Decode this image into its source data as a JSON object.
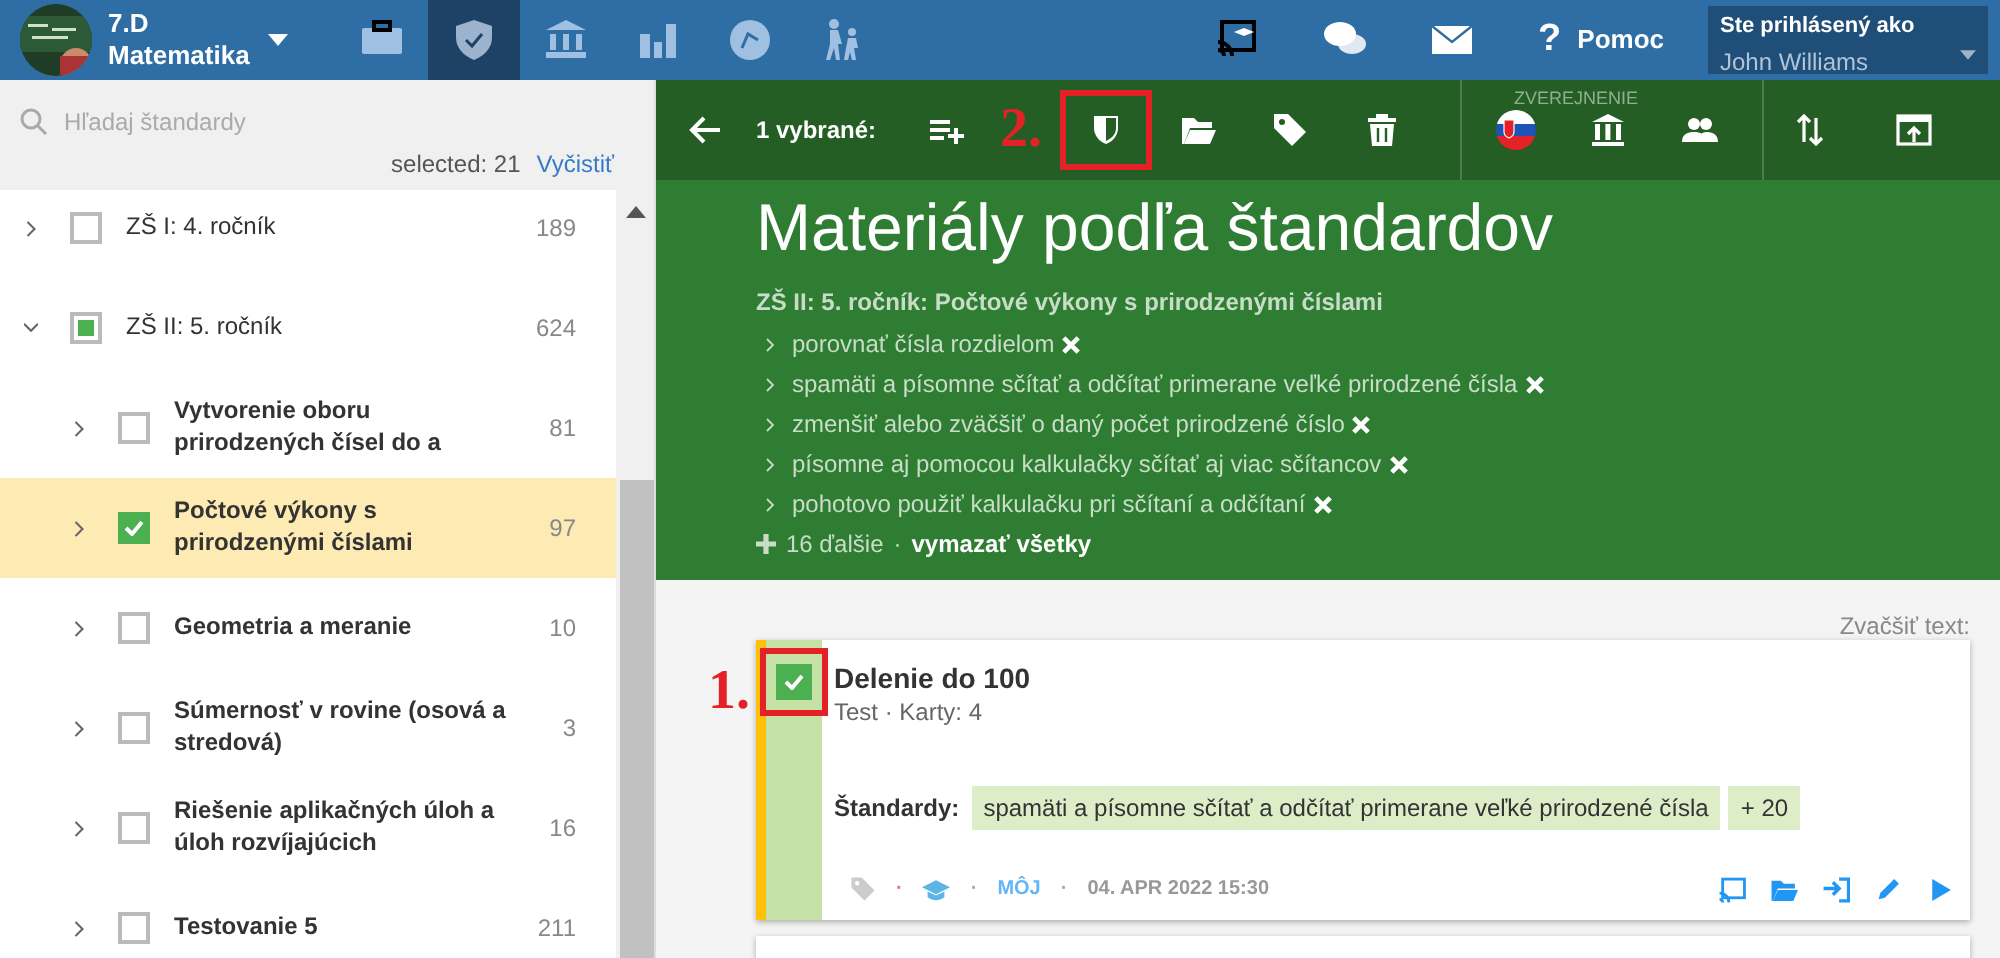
{
  "topbar": {
    "class_name": "7.D",
    "subject": "Matematika",
    "nav_tabs": [
      {
        "selected": false
      },
      {
        "selected": true
      },
      {
        "selected": false
      },
      {
        "selected": false
      },
      {
        "selected": false
      },
      {
        "selected": false
      }
    ],
    "help_mark": "?",
    "help_label": "Pomoc",
    "login_label": "Ste prihlásený ako",
    "user": "John Williams"
  },
  "sidebar": {
    "search_placeholder": "Hľadaj štandardy",
    "selected_count": "selected: 21",
    "clear_link": "Vyčistiť",
    "tree": [
      {
        "label": "ZŠ I: 4. ročník",
        "count": "189",
        "expanded": false,
        "checked": false,
        "partial": false,
        "selected": false
      },
      {
        "label": "ZŠ II: 5. ročník",
        "count": "624",
        "expanded": true,
        "checked": false,
        "partial": true,
        "selected": false,
        "children": [
          {
            "label": "Vytvorenie oboru prirodzených čísel do a",
            "count": "81",
            "expanded": false,
            "checked": false,
            "partial": false,
            "selected": false
          },
          {
            "label": "Počtové výkony s prirodzenými číslami",
            "count": "97",
            "expanded": false,
            "checked": true,
            "partial": false,
            "selected": true
          },
          {
            "label": "Geometria a meranie",
            "count": "10",
            "expanded": false,
            "checked": false,
            "partial": false,
            "selected": false
          },
          {
            "label": "Súmernosť v rovine (osová a stredová)",
            "count": "3",
            "expanded": false,
            "checked": false,
            "partial": false,
            "selected": false
          },
          {
            "label": "Riešenie aplikačných úloh a úloh rozvíjajúcich",
            "count": "16",
            "expanded": false,
            "checked": false,
            "partial": false,
            "selected": false
          },
          {
            "label": "Testovanie 5",
            "count": "211",
            "expanded": false,
            "checked": false,
            "partial": false,
            "selected": false
          }
        ]
      }
    ]
  },
  "toolbar": {
    "selection": "1 vybrané:",
    "annotation": "2.",
    "publish_label": "ZVEREJNENIE"
  },
  "heading": {
    "title": "Materiály podľa štandardov",
    "path": "ZŠ II: 5. ročník: Počtové výkony s prirodzenými číslami",
    "standards": [
      "porovnať čísla rozdielom",
      "spamäti a písomne sčítať a odčítať primerane veľké prirodzené čísla",
      "zmenšiť alebo zväčšiť o daný počet prirodzené číslo",
      "písomne aj pomocou kalkulačky sčítať aj viac sčítancov",
      "pohotovo použiť kalkulačku pri sčítaní a odčítaní"
    ],
    "more": "16 ďalšie",
    "sep": "·",
    "clear_all": "vymazať všetky"
  },
  "zoom_label": "Zvačšiť text:",
  "card": {
    "annotation": "1.",
    "checked": true,
    "title": "Delenie do 100",
    "meta": "Test · Karty: 4",
    "standards_label": "Štandardy:",
    "chips": [
      "spamäti a písomne sčítať a odčítať primerane veľké prirodzené čísla",
      "+ 20"
    ],
    "separators": [
      "·",
      "·",
      "·"
    ],
    "owner": "MÔJ",
    "date": "04. APR 2022 15:30"
  }
}
